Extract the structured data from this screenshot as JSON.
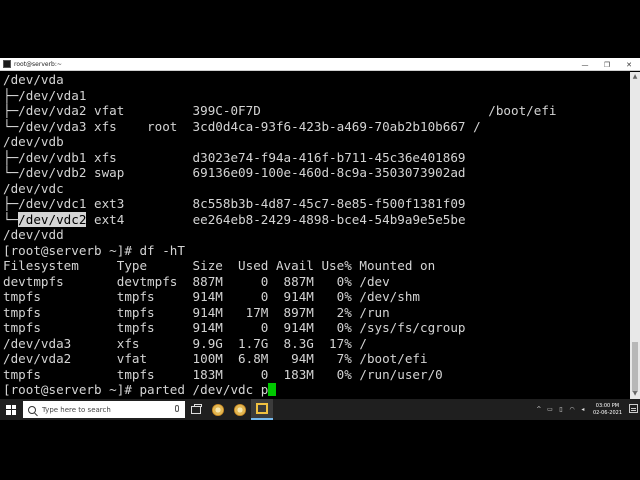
{
  "window": {
    "title": "root@serverb:~",
    "minimize_glyph": "—",
    "maximize_glyph": "❐",
    "close_glyph": "✕"
  },
  "terminal": {
    "lines": [
      "/dev/vda",
      "├─/dev/vda1",
      "├─/dev/vda2 vfat         399C-0F7D                              /boot/efi",
      "└─/dev/vda3 xfs    root  3cd0d4ca-93f6-423b-a469-70ab2b10b667 /",
      "/dev/vdb",
      "├─/dev/vdb1 xfs          d3023e74-f94a-416f-b711-45c36e401869",
      "└─/dev/vdb2 swap         69136e09-100e-460d-8c9a-3503073902ad",
      "/dev/vdc",
      "├─/dev/vdc1 ext3         8c558b3b-4d87-45c7-8e85-f500f1381f09",
      "",
      "/dev/vdd",
      "[root@serverb ~]# df -hT",
      "Filesystem     Type      Size  Used Avail Use% Mounted on",
      "devtmpfs       devtmpfs  887M     0  887M   0% /dev",
      "tmpfs          tmpfs     914M     0  914M   0% /dev/shm",
      "tmpfs          tmpfs     914M   17M  897M   2% /run",
      "tmpfs          tmpfs     914M     0  914M   0% /sys/fs/cgroup",
      "/dev/vda3      xfs       9.9G  1.7G  8.3G  17% /",
      "/dev/vda2      vfat      100M  6.8M   94M   7% /boot/efi",
      "tmpfs          tmpfs     183M     0  183M   0% /run/user/0"
    ],
    "vdc2_prefix": "└─",
    "vdc2_highlight": "/dev/vdc2",
    "vdc2_suffix": " ext4         ee264eb8-2429-4898-bce4-54b9a9e5e5be",
    "prompt_line": "[root@serverb ~]# parted /dev/vdc p",
    "cursor_color": "#00c800"
  },
  "taskbar": {
    "search_placeholder": "Type here to search",
    "clock_time": "03:00 PM",
    "clock_date": "02-06-2021"
  },
  "colors": {
    "terminal_bg": "#000000",
    "terminal_fg": "#d4d4d4",
    "taskbar_bg": "#1f1f1f"
  }
}
